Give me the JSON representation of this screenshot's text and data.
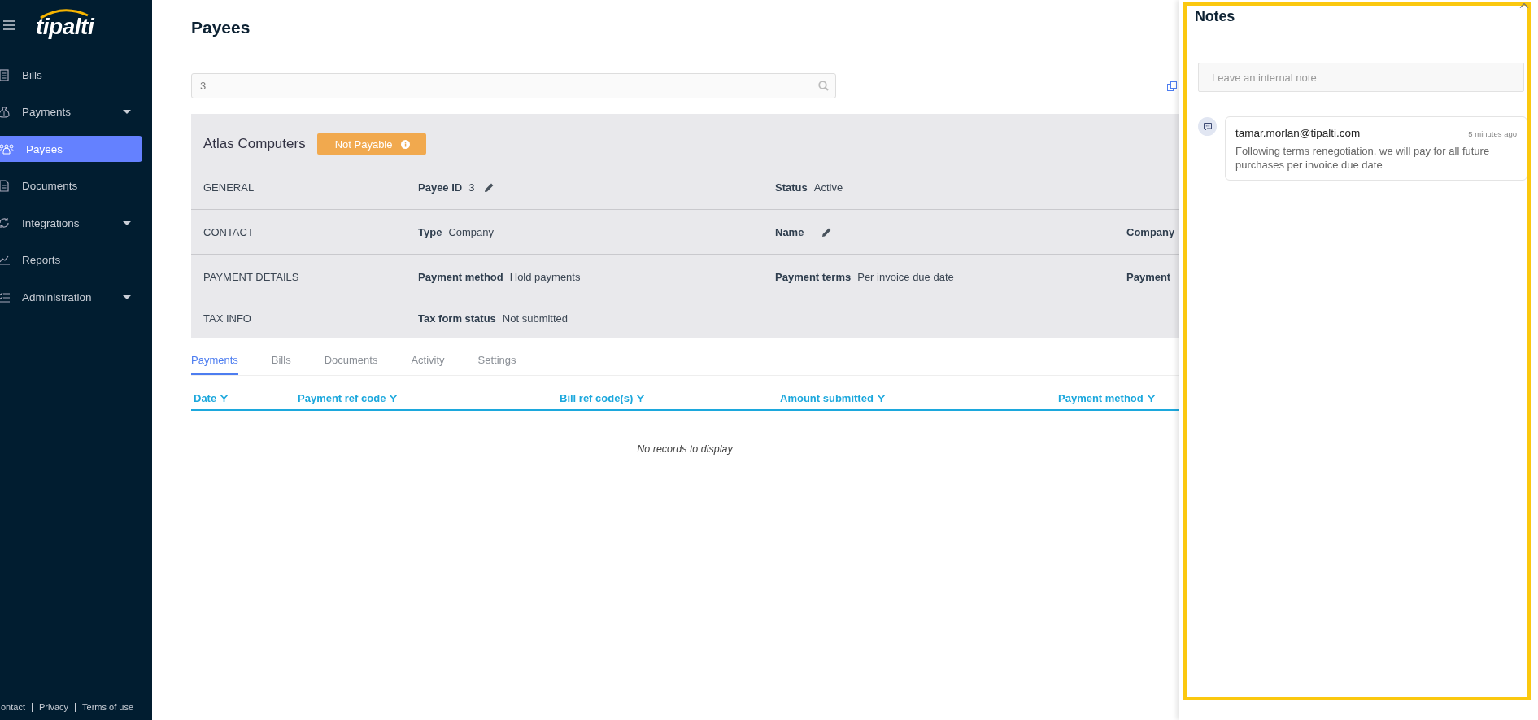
{
  "sidebar": {
    "logo": "tipalti",
    "items": [
      {
        "label": "Bills",
        "selected": false,
        "expandable": false
      },
      {
        "label": "Payments",
        "selected": false,
        "expandable": true
      },
      {
        "label": "Payees",
        "selected": true,
        "expandable": false
      },
      {
        "label": "Documents",
        "selected": false,
        "expandable": false
      },
      {
        "label": "Integrations",
        "selected": false,
        "expandable": true
      },
      {
        "label": "Reports",
        "selected": false,
        "expandable": false
      },
      {
        "label": "Administration",
        "selected": false,
        "expandable": true
      }
    ],
    "footer_links": [
      "ontact",
      "Privacy",
      "Terms of use"
    ]
  },
  "page": {
    "title": "Payees",
    "search": {
      "value": "3"
    }
  },
  "payee": {
    "name": "Atlas Computers",
    "badge": "Not Payable",
    "sections": [
      {
        "heading": "GENERAL",
        "fields": [
          {
            "label": "Payee ID",
            "value": "3",
            "editable": true
          },
          {
            "label": "Status",
            "value": "Active",
            "editable": false
          }
        ]
      },
      {
        "heading": "CONTACT",
        "fields": [
          {
            "label": "Type",
            "value": "Company",
            "editable": false
          },
          {
            "label": "Name",
            "editable": true
          },
          {
            "label": "Company",
            "editable": false
          }
        ]
      },
      {
        "heading": "PAYMENT DETAILS",
        "fields": [
          {
            "label": "Payment method",
            "value": "Hold payments",
            "editable": false
          },
          {
            "label": "Payment terms",
            "value": "Per invoice due date",
            "editable": false
          },
          {
            "label": "Payment",
            "editable": false
          }
        ]
      },
      {
        "heading": "TAX INFO",
        "fields": [
          {
            "label": "Tax form status",
            "value": "Not submitted",
            "editable": false
          }
        ]
      }
    ]
  },
  "tabs": [
    {
      "label": "Payments",
      "selected": true
    },
    {
      "label": "Bills",
      "selected": false
    },
    {
      "label": "Documents",
      "selected": false
    },
    {
      "label": "Activity",
      "selected": false
    },
    {
      "label": "Settings",
      "selected": false
    }
  ],
  "table": {
    "columns": [
      "Date",
      "Payment ref code",
      "Bill ref code(s)",
      "Amount submitted",
      "Payment method"
    ],
    "empty_message": "No records to display"
  },
  "notes": {
    "title": "Notes",
    "placeholder": "Leave an internal note",
    "items": [
      {
        "author": "tamar.morlan@tipalti.com",
        "time": "5 minutes ago",
        "text": "Following terms renegotiation, we will pay for all future purchases per invoice due date"
      }
    ]
  }
}
